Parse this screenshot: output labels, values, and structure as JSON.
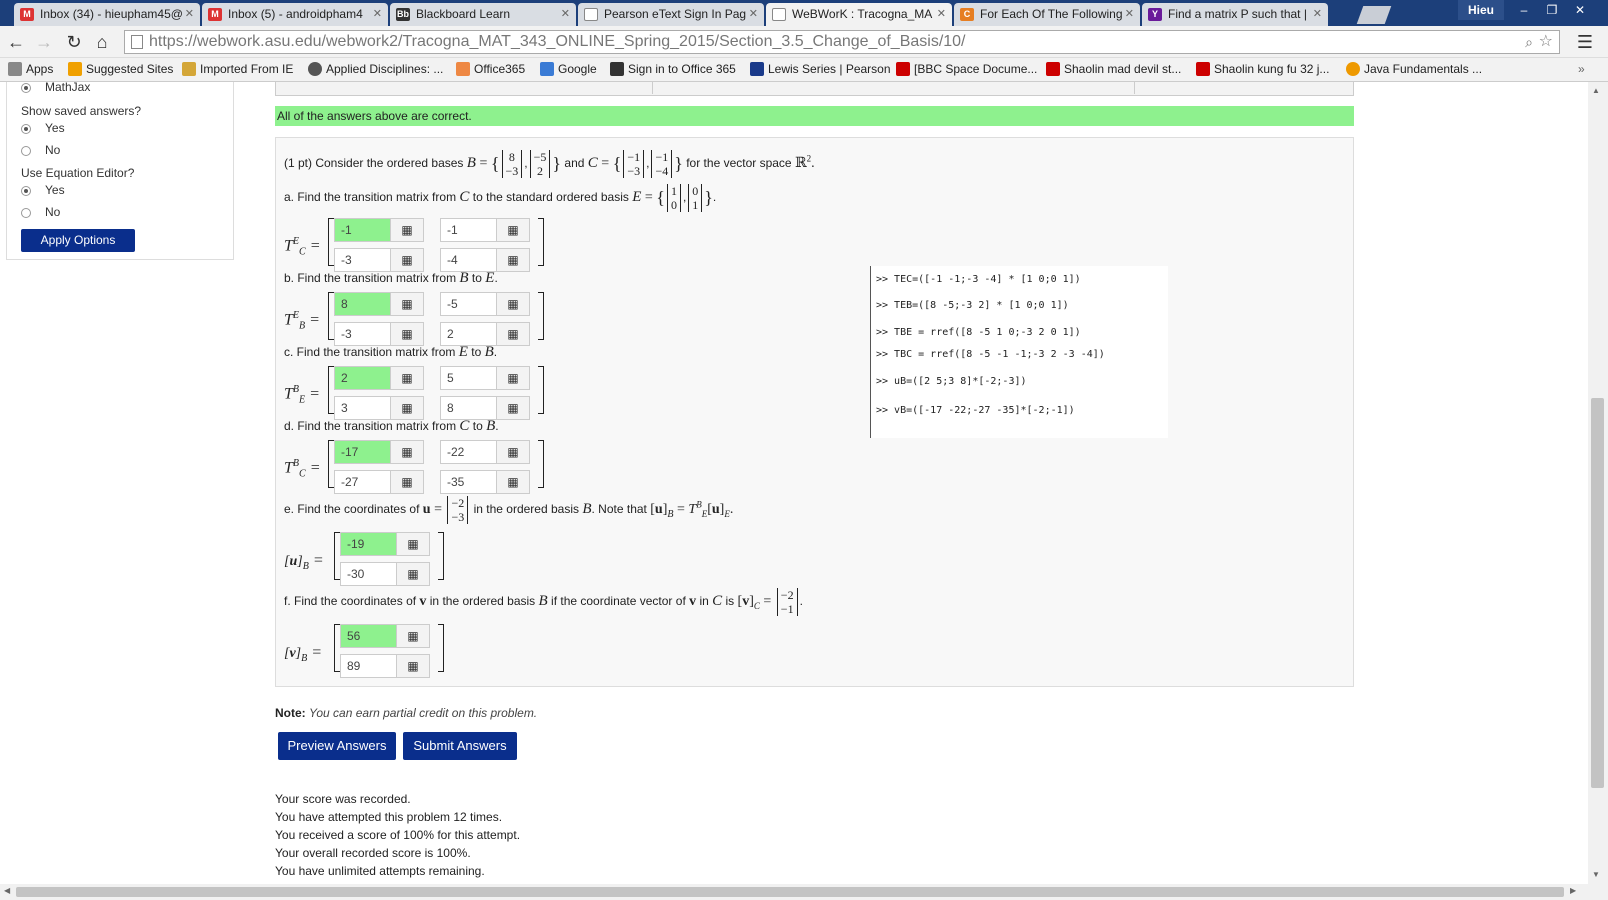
{
  "browser": {
    "tabs": [
      {
        "title": "Inbox (34) - hieupham45@",
        "icon_color": "#d33",
        "icon_glyph": "M"
      },
      {
        "title": "Inbox (5) - androidpham4",
        "icon_color": "#d33",
        "icon_glyph": "M"
      },
      {
        "title": "Blackboard Learn",
        "icon_color": "#333",
        "icon_glyph": "Bb"
      },
      {
        "title": "Pearson eText Sign In Pag",
        "icon_color": "#666",
        "icon_glyph": "P"
      },
      {
        "title": "WeBWorK : Tracogna_MA",
        "icon_color": "#666",
        "icon_glyph": "W"
      },
      {
        "title": "For Each Of The Following",
        "icon_color": "#e67e22",
        "icon_glyph": "C"
      },
      {
        "title": "Find a matrix P such that |",
        "icon_color": "#6a1b9a",
        "icon_glyph": "Y"
      }
    ],
    "user": "Hieu",
    "url": "https://webwork.asu.edu/webwork2/Tracogna_MAT_343_ONLINE_Spring_2015/Section_3.5_Change_of_Basis/10/",
    "bookmarks": [
      {
        "label": "Apps",
        "color": "#888"
      },
      {
        "label": "Suggested Sites",
        "color": "#f0a000"
      },
      {
        "label": "Imported From IE",
        "color": "#d4a637"
      },
      {
        "label": "Applied Disciplines: ...",
        "color": "#555"
      },
      {
        "label": "Office365",
        "color": "#e84"
      },
      {
        "label": "Google",
        "color": "#3a7bd5"
      },
      {
        "label": "Sign in to Office 365",
        "color": "#333"
      },
      {
        "label": "Lewis Series | Pearson",
        "color": "#1a3a8a"
      },
      {
        "label": "[BBC Space Docume...",
        "color": "#c00"
      },
      {
        "label": "Shaolin mad devil st...",
        "color": "#c00"
      },
      {
        "label": "Shaolin kung fu 32 j...",
        "color": "#c00"
      },
      {
        "label": "Java Fundamentals ...",
        "color": "#e90"
      }
    ],
    "more": "»"
  },
  "sidebar": {
    "mathjax_label": "MathJax",
    "saved_answers_label": "Show saved answers?",
    "editor_label": "Use Equation Editor?",
    "yes": "Yes",
    "no": "No",
    "apply_button": "Apply Options"
  },
  "banner": "All of the answers above are correct.",
  "problem": {
    "intro_prefix": "(1 pt) Consider the ordered bases",
    "intro_and": "and",
    "intro_suffix": "for the vector space",
    "part_a": "a. Find the transition matrix from",
    "part_a_to": "to the standard ordered basis",
    "part_b": "b. Find the transition matrix from",
    "part_c": "c. Find the transition matrix from",
    "part_d": "d. Find the transition matrix from",
    "to": "to",
    "part_e": "e. Find the coordinates of",
    "part_e_mid": "in the ordered basis",
    "part_e_note": ". Note that",
    "part_f": "f. Find the coordinates of",
    "part_f_mid": "in the ordered basis",
    "part_f_if": "if the coordinate vector of",
    "part_f_in": "in",
    "part_f_is": "is",
    "answers": {
      "TCE": [
        "-1",
        "-1",
        "-3",
        "-4"
      ],
      "TBE": [
        "8",
        "-5",
        "-3",
        "2"
      ],
      "TEB": [
        "2",
        "5",
        "3",
        "8"
      ],
      "TCB": [
        "-17",
        "-22",
        "-27",
        "-35"
      ],
      "uB": [
        "-19",
        "-30"
      ],
      "vB": [
        "56",
        "89"
      ]
    },
    "equation_editor_icon": "grid-icon"
  },
  "console": [
    ">> TEC=([-1 -1;-3 -4] * [1 0;0 1])",
    ">> TEB=([8 -5;-3 2] * [1 0;0 1])",
    ">> TBE = rref([8 -5 1 0;-3 2 0 1])",
    ">> TBC = rref([8 -5 -1 -1;-3 2 -3 -4])",
    ">> uB=([2 5;3 8]*[-2;-3])",
    ">> vB=([-17 -22;-27 -35]*[-2;-1])"
  ],
  "note": {
    "label": "Note:",
    "text": "You can earn partial credit on this problem."
  },
  "buttons": {
    "preview": "Preview Answers",
    "submit": "Submit Answers"
  },
  "status": [
    "Your score was recorded.",
    "You have attempted this problem 12 times.",
    "You received a score of 100% for this attempt.",
    "Your overall recorded score is 100%.",
    "You have unlimited attempts remaining."
  ],
  "colors": {
    "correct": "#8ef18e",
    "button": "#0a2e8c",
    "tabbar": "#1c3f7a"
  }
}
